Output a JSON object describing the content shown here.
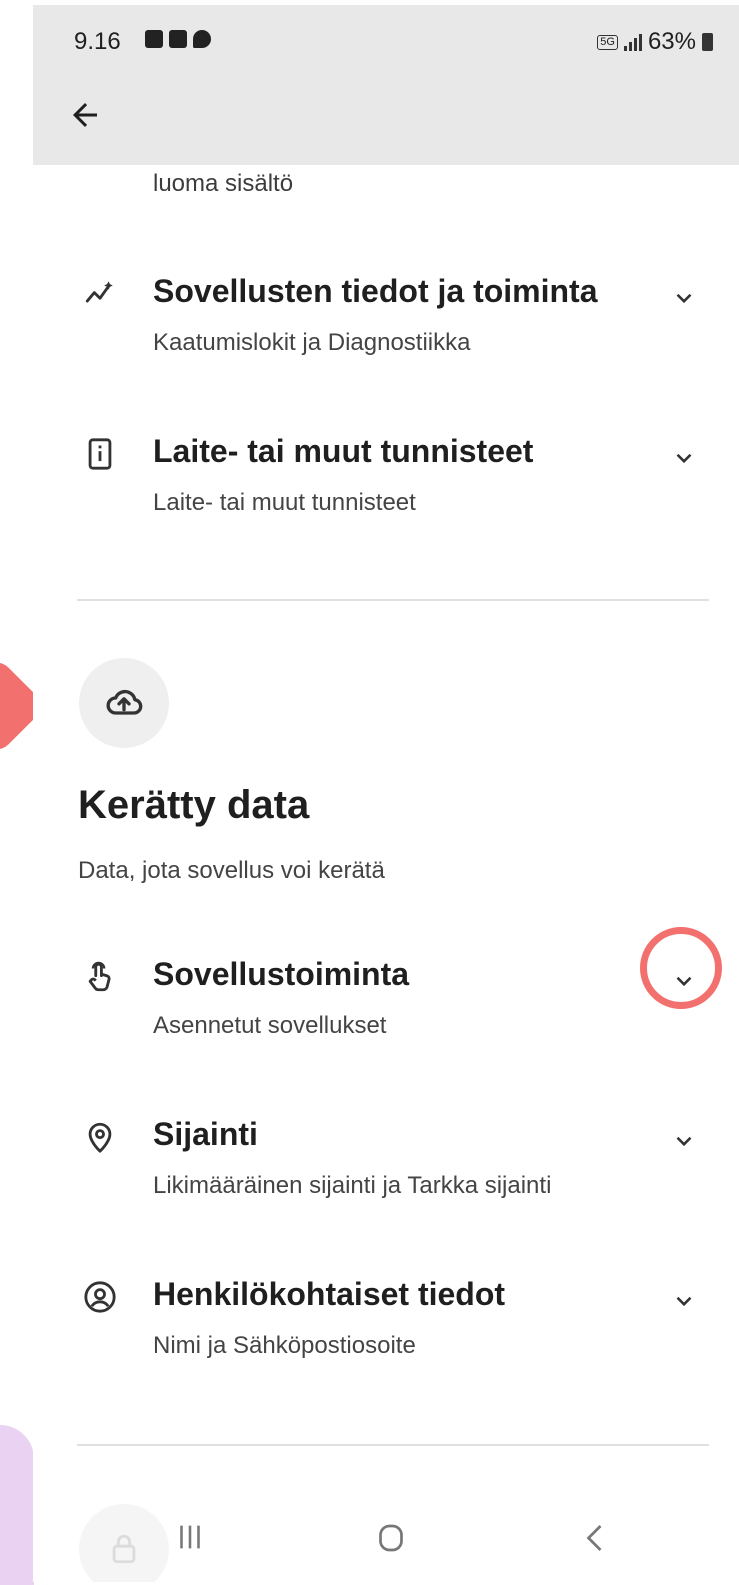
{
  "status_bar": {
    "time": "9.16",
    "network": "5G",
    "battery": "63%"
  },
  "top": {
    "truncated_text": "luoma sisältö"
  },
  "shared_items": [
    {
      "title": "Sovellusten tiedot ja toiminta",
      "subtitle": "Kaatumislokit ja Diagnostiikka",
      "icon": "sparkle-chart-icon"
    },
    {
      "title": "Laite- tai muut tunnisteet",
      "subtitle": "Laite- tai muut tunnisteet",
      "icon": "device-info-icon"
    }
  ],
  "collected_section": {
    "icon": "cloud-upload-icon",
    "title": "Kerätty data",
    "subtitle": "Data, jota sovellus voi kerätä",
    "items": [
      {
        "title": "Sovellustoiminta",
        "subtitle": "Asennetut sovellukset",
        "icon": "touch-app-icon"
      },
      {
        "title": "Sijainti",
        "subtitle": "Likimääräinen sijainti ja Tarkka sijainti",
        "icon": "location-pin-icon"
      },
      {
        "title": "Henkilökohtaiset tiedot",
        "subtitle": "Nimi ja Sähköpostiosoite",
        "icon": "account-circle-icon"
      }
    ]
  },
  "annotation": {
    "highlight_color": "#f2716f",
    "accent_lilac": "#ead2f3"
  }
}
